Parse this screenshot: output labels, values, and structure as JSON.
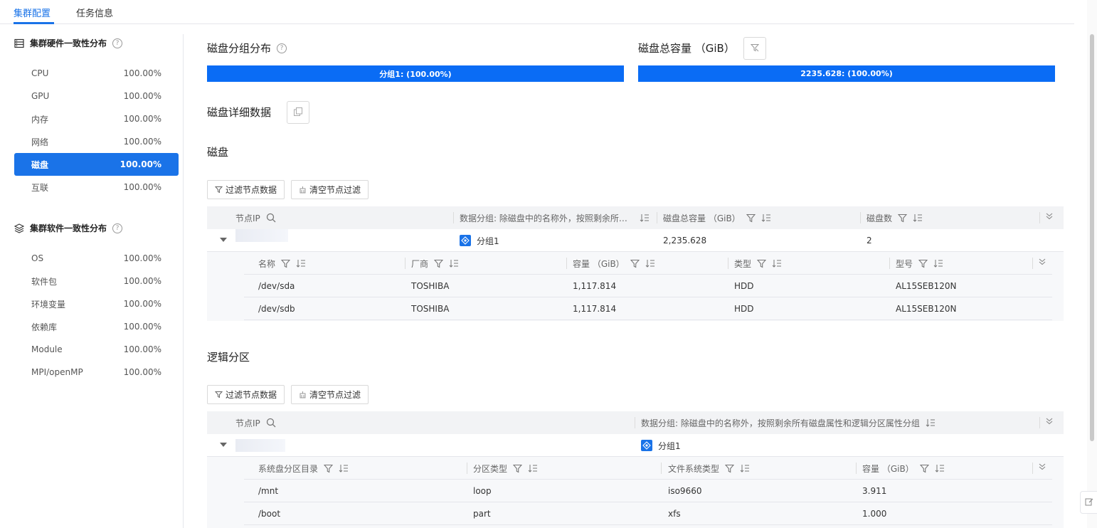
{
  "tabs": [
    {
      "label": "集群配置",
      "active": true
    },
    {
      "label": "任务信息",
      "active": false
    }
  ],
  "sidebar": {
    "hardware_title": "集群硬件一致性分布",
    "hardware_items": [
      {
        "label": "CPU",
        "value": "100.00%"
      },
      {
        "label": "GPU",
        "value": "100.00%"
      },
      {
        "label": "内存",
        "value": "100.00%"
      },
      {
        "label": "网络",
        "value": "100.00%"
      },
      {
        "label": "磁盘",
        "value": "100.00%",
        "active": true
      },
      {
        "label": "互联",
        "value": "100.00%"
      }
    ],
    "software_title": "集群软件一致性分布",
    "software_items": [
      {
        "label": "OS",
        "value": "100.00%"
      },
      {
        "label": "软件包",
        "value": "100.00%"
      },
      {
        "label": "环境变量",
        "value": "100.00%"
      },
      {
        "label": "依赖库",
        "value": "100.00%"
      },
      {
        "label": "Module",
        "value": "100.00%"
      },
      {
        "label": "MPI/openMP",
        "value": "100.00%"
      }
    ]
  },
  "main": {
    "group_title": "磁盘分组分布",
    "group_bar": "分组1: (100.00%)",
    "capacity_title": "磁盘总容量 （GiB）",
    "capacity_bar": "2235.628: (100.00%)",
    "detail_title": "磁盘详细数据",
    "disk_section": "磁盘",
    "partition_section": "逻辑分区",
    "filter_btn": "过滤节点数据",
    "clear_btn": "清空节点过滤"
  },
  "disk_table": {
    "headers": [
      "节点IP",
      "数据分组: 除磁盘中的名称外，按照剩余所有...",
      "磁盘总容量 （GiB）",
      "磁盘数"
    ],
    "row": {
      "group": "分组1",
      "capacity": "2,235.628",
      "count": "2"
    },
    "sub_headers": [
      "名称",
      "厂商",
      "容量 （GiB）",
      "类型",
      "型号"
    ],
    "sub_rows": [
      [
        "/dev/sda",
        "TOSHIBA",
        "1,117.814",
        "HDD",
        "AL15SEB120N"
      ],
      [
        "/dev/sdb",
        "TOSHIBA",
        "1,117.814",
        "HDD",
        "AL15SEB120N"
      ]
    ]
  },
  "partition_table": {
    "headers": [
      "节点IP",
      "数据分组: 除磁盘中的名称外，按照剩余所有磁盘属性和逻辑分区属性分组"
    ],
    "row": {
      "group": "分组1"
    },
    "sub_headers": [
      "系统盘分区目录",
      "分区类型",
      "文件系统类型",
      "容量 （GiB）"
    ],
    "sub_rows": [
      [
        "/mnt",
        "loop",
        "iso9660",
        "3.911"
      ],
      [
        "/boot",
        "part",
        "xfs",
        "1.000"
      ]
    ]
  },
  "colors": {
    "accent": "#1a73e8",
    "bar": "#0a6cf5"
  }
}
